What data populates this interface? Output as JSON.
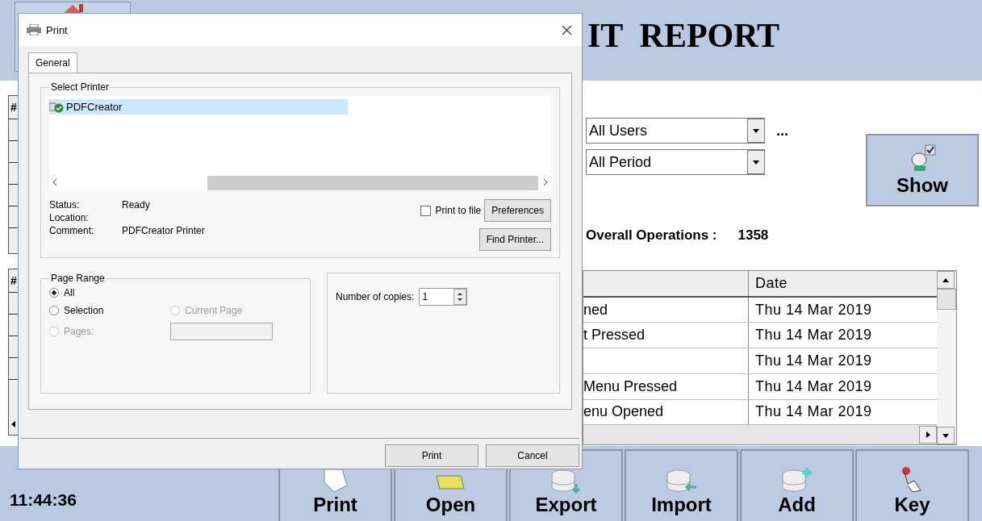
{
  "app": {
    "title": "IT  REPORT",
    "users_filter": "All Users",
    "more": "...",
    "period_filter": "All Period",
    "show_button": "Show",
    "overall_label": "Overall Operations :",
    "overall_value": "1358",
    "top_grid": {
      "header": "#"
    },
    "log_table": {
      "index_header": "#",
      "columns": [
        "",
        "Date"
      ],
      "rows": [
        {
          "column_2": "ned",
          "date": "Thu 14 Mar 2019"
        },
        {
          "column_2": "t Pressed",
          "date": "Thu 14 Mar 2019"
        },
        {
          "column_2": "",
          "date": "Thu 14 Mar 2019"
        },
        {
          "column_2": "Menu Pressed",
          "date": "Thu 14 Mar 2019"
        },
        {
          "column_2": "enu Opened",
          "date": "Thu 14 Mar 2019"
        }
      ]
    },
    "clock": "11:44:36",
    "toolbar": [
      {
        "label": "Print",
        "kind": "page"
      },
      {
        "label": "Open",
        "kind": "folder"
      },
      {
        "label": "Export",
        "kind": "export"
      },
      {
        "label": "Import",
        "kind": "import"
      },
      {
        "label": "Add",
        "kind": "add"
      },
      {
        "label": "Key",
        "kind": "hand"
      }
    ]
  },
  "dialog": {
    "title": "Print",
    "tabs": [
      {
        "label": "General",
        "selected": true
      }
    ],
    "select_printer": {
      "title": "Select Printer",
      "printers": [
        {
          "name": "PDFCreator",
          "selected": true
        }
      ],
      "info": [
        {
          "label": "Status:",
          "value": "Ready"
        },
        {
          "label": "Location:"
        },
        {
          "label": "Comment:",
          "value": "PDFCreator Printer"
        }
      ],
      "print_to_file": {
        "label": "Print to file",
        "checked": false
      },
      "preferences": "Preferences",
      "find_printer": "Find Printer..."
    },
    "page_range": {
      "title": "Page Range",
      "options": [
        {
          "label": "All",
          "selected": true,
          "disabled": false
        },
        {
          "label": "Selection",
          "selected": false,
          "disabled": false
        },
        {
          "label": "Current Page",
          "selected": false,
          "disabled": true
        },
        {
          "label": "Pages:",
          "selected": false,
          "disabled": true
        }
      ]
    },
    "copies": {
      "label": "Number of copies:",
      "value": "1"
    },
    "buttons": [
      "Print",
      "Cancel"
    ]
  }
}
